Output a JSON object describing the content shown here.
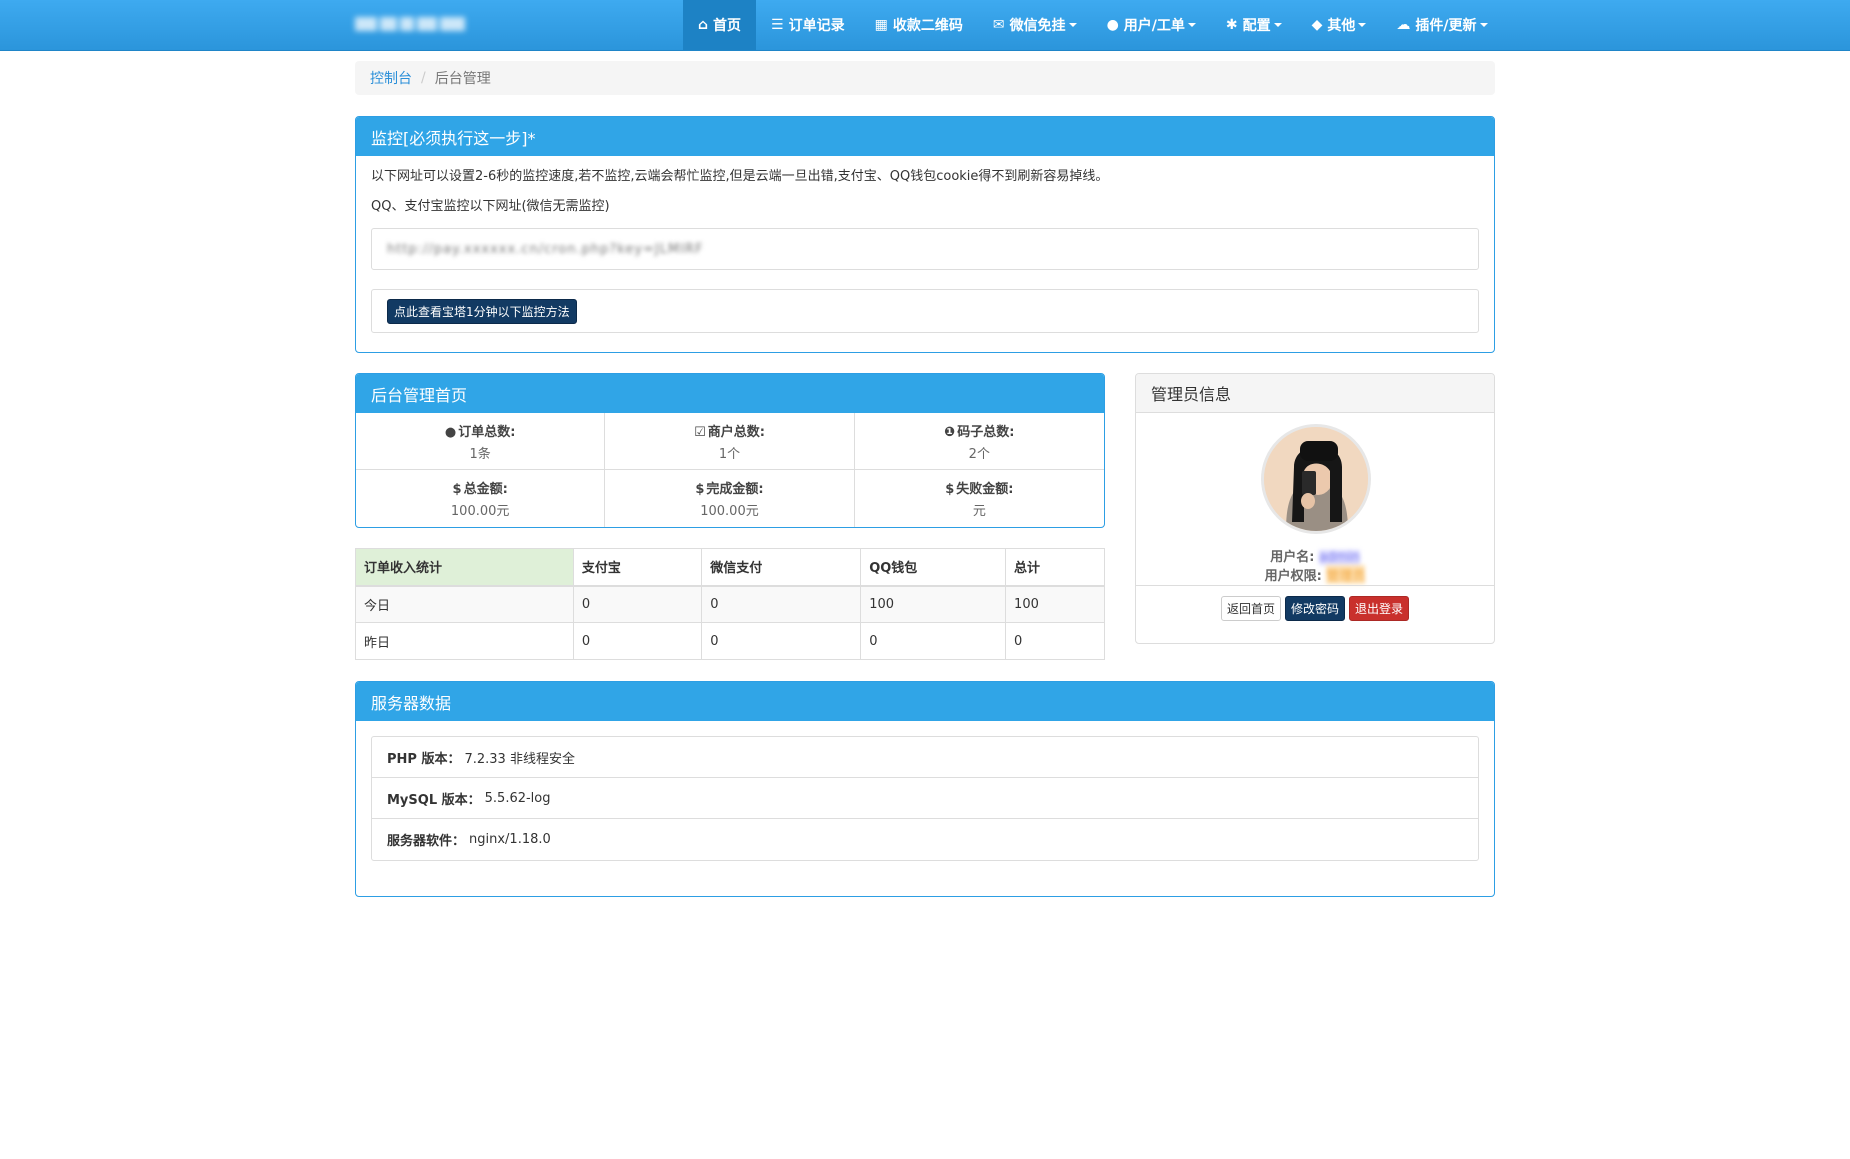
{
  "nav": {
    "items": [
      {
        "label": "首页",
        "icon": "home-icon",
        "glyph": "⌂"
      },
      {
        "label": "订单记录",
        "icon": "list-icon",
        "glyph": "☰"
      },
      {
        "label": "收款二维码",
        "icon": "qrcode-icon",
        "glyph": "▦"
      },
      {
        "label": "微信免挂",
        "icon": "wechat-icon",
        "glyph": "✉"
      },
      {
        "label": "用户/工单",
        "icon": "user-icon",
        "glyph": "●"
      },
      {
        "label": "配置",
        "icon": "gear-icon",
        "glyph": "✱"
      },
      {
        "label": "其他",
        "icon": "cube-icon",
        "glyph": "◆"
      },
      {
        "label": "插件/更新",
        "icon": "cloud-icon",
        "glyph": "☁"
      }
    ]
  },
  "breadcrumb": {
    "home": "控制台",
    "current": "后台管理"
  },
  "monitor": {
    "title": "监控[必须执行这一步]*",
    "desc1": "以下网址可以设置2-6秒的监控速度,若不监控,云端会帮忙监控,但是云端一旦出错,支付宝、QQ钱包cookie得不到刷新容易掉线。",
    "desc2": "QQ、支付宝监控以下网址(微信无需监控)",
    "url": "http://pay.xxxxxx.cn/cron.php?key=JLMIRF",
    "button": "点此查看宝塔1分钟以下监控方法"
  },
  "home": {
    "title": "后台管理首页",
    "stats": [
      {
        "label": "订单总数:",
        "value": "1条",
        "icon": "drop-icon",
        "glyph": "●"
      },
      {
        "label": "商户总数:",
        "value": "1个",
        "icon": "check-square-icon",
        "glyph": "☑"
      },
      {
        "label": "码子总数:",
        "value": "2个",
        "icon": "info-circle-icon",
        "glyph": "❶"
      },
      {
        "label": "总金额:",
        "value": "100.00元",
        "icon": "dollar-icon",
        "glyph": "$"
      },
      {
        "label": "完成金额:",
        "value": "100.00元",
        "icon": "dollar-icon",
        "glyph": "$"
      },
      {
        "label": "失败金额:",
        "value": "元",
        "icon": "dollar-icon",
        "glyph": "$"
      }
    ]
  },
  "income": {
    "headers": [
      "订单收入统计",
      "支付宝",
      "微信支付",
      "QQ钱包",
      "总计"
    ],
    "rows": [
      [
        "今日",
        "0",
        "0",
        "100",
        "100"
      ],
      [
        "昨日",
        "0",
        "0",
        "0",
        "0"
      ]
    ]
  },
  "admin": {
    "title": "管理员信息",
    "username_label": "用户名:",
    "username": "admin",
    "role_label": "用户权限:",
    "role": "管理员",
    "buttons": {
      "back": "返回首页",
      "change_pwd": "修改密码",
      "logout": "退出登录"
    }
  },
  "server": {
    "title": "服务器数据",
    "items": [
      {
        "label": "PHP 版本：",
        "value": "7.2.33 非线程安全"
      },
      {
        "label": "MySQL 版本：",
        "value": "5.5.62-log"
      },
      {
        "label": "服务器软件：",
        "value": "nginx/1.18.0"
      }
    ]
  },
  "colors": {
    "nav": "#2b95db",
    "panel_head": "#30a5e7",
    "btn_dark": "#123a63",
    "btn_danger": "#c9302c",
    "success_bg": "#dff0d8"
  }
}
